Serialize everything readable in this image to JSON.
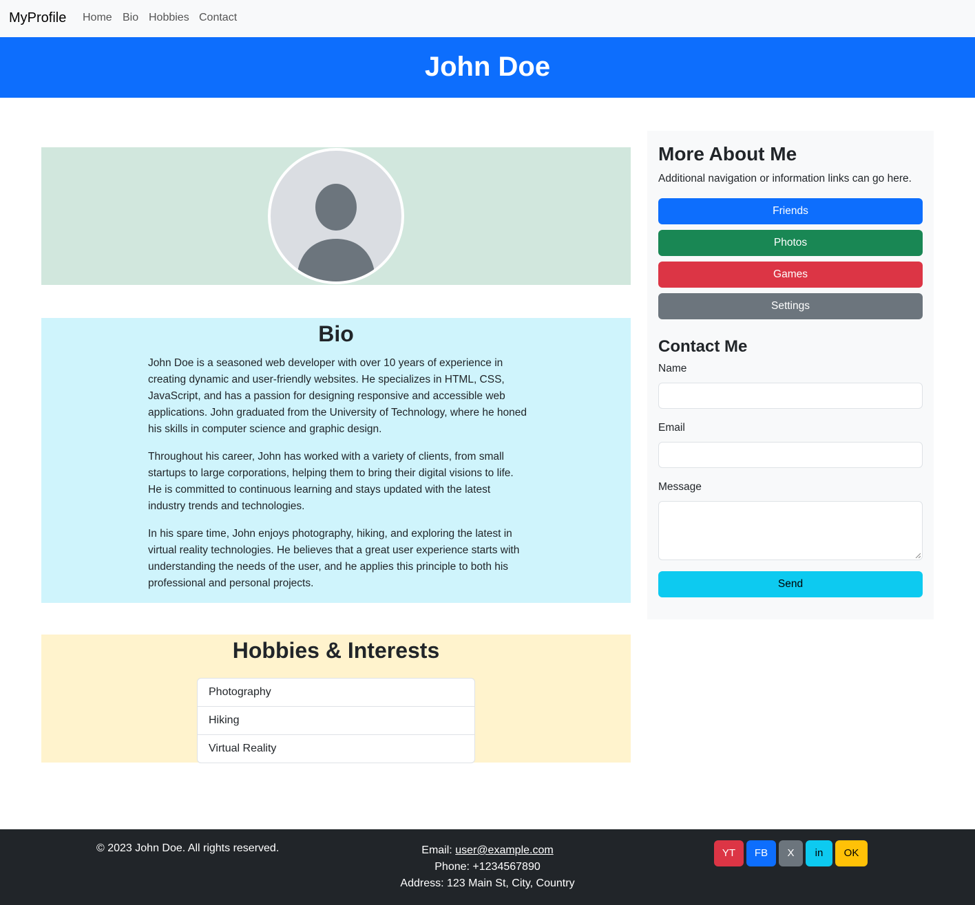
{
  "navbar": {
    "brand": "MyProfile",
    "links": [
      "Home",
      "Bio",
      "Hobbies",
      "Contact"
    ]
  },
  "header": {
    "title": "John Doe"
  },
  "bio": {
    "heading": "Bio",
    "paragraphs": [
      "John Doe is a seasoned web developer with over 10 years of experience in creating dynamic and user-friendly websites. He specializes in HTML, CSS, JavaScript, and has a passion for designing responsive and accessible web applications. John graduated from the University of Technology, where he honed his skills in computer science and graphic design.",
      "Throughout his career, John has worked with a variety of clients, from small startups to large corporations, helping them to bring their digital visions to life. He is committed to continuous learning and stays updated with the latest industry trends and technologies.",
      "In his spare time, John enjoys photography, hiking, and exploring the latest in virtual reality technologies. He believes that a great user experience starts with understanding the needs of the user, and he applies this principle to both his professional and personal projects."
    ]
  },
  "hobbies": {
    "heading": "Hobbies & Interests",
    "items": [
      "Photography",
      "Hiking",
      "Virtual Reality"
    ]
  },
  "sidebar": {
    "heading": "More About Me",
    "description": "Additional navigation or information links can go here.",
    "buttons": [
      {
        "label": "Friends",
        "color": "#0d6efd"
      },
      {
        "label": "Photos",
        "color": "#198754"
      },
      {
        "label": "Games",
        "color": "#dc3545"
      },
      {
        "label": "Settings",
        "color": "#6c757d"
      }
    ],
    "contact": {
      "heading": "Contact Me",
      "name_label": "Name",
      "name_value": "",
      "email_label": "Email",
      "email_value": "",
      "message_label": "Message",
      "message_value": "",
      "send_label": "Send",
      "send_color": "#0dcaf0"
    }
  },
  "footer": {
    "copyright": "© 2023 John Doe. All rights reserved.",
    "email_prefix": "Email: ",
    "email": "user@example.com",
    "phone": "Phone: +1234567890",
    "address": "Address: 123 Main St, City, Country",
    "social": [
      {
        "label": "YT",
        "color": "#dc3545"
      },
      {
        "label": "FB",
        "color": "#0d6efd"
      },
      {
        "label": "X",
        "color": "#6c757d"
      },
      {
        "label": "in",
        "color": "#0dcaf0"
      },
      {
        "label": "OK",
        "color": "#ffc107"
      }
    ]
  },
  "colors": {
    "primary": "#0d6efd",
    "banner_bg": "#d1e7dd",
    "bio_bg": "#cff4fc",
    "hobbies_bg": "#fff3cd",
    "footer_bg": "#212529"
  }
}
